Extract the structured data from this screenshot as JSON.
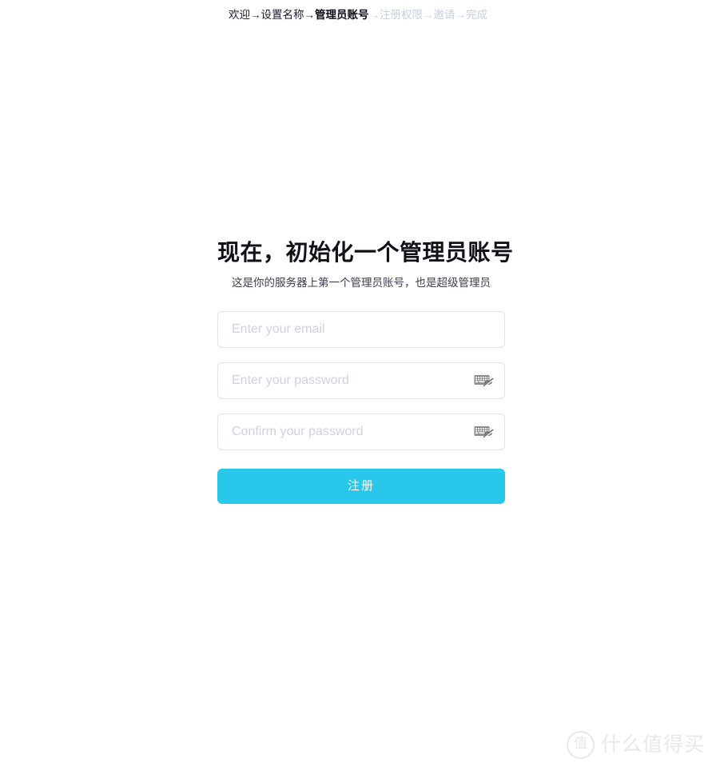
{
  "breadcrumb": {
    "completed_steps": "欢迎→设置名称→",
    "current_step": "管理员账号",
    "upcoming_steps": "→注册权限→邀请→完成",
    "active_color": "#0d0d1a",
    "inactive_color": "#c9cfe0"
  },
  "page": {
    "title": "现在，初始化一个管理员账号",
    "subtitle": "这是你的服务器上第一个管理员账号，也是超级管理员"
  },
  "form": {
    "email": {
      "placeholder": "Enter your email",
      "value": ""
    },
    "password": {
      "placeholder": "Enter your password",
      "value": "",
      "icon": "keyboard-off-icon"
    },
    "confirm_password": {
      "placeholder": "Confirm your password",
      "value": "",
      "icon": "keyboard-off-icon"
    },
    "submit_label": "注册",
    "submit_color": "#2ac7ec",
    "input_border_color": "#dfe3ec",
    "placeholder_color": "#ccd2e0"
  },
  "watermark": {
    "logo_char": "值",
    "text": "什么值得买",
    "color": "#e8e8e8"
  }
}
